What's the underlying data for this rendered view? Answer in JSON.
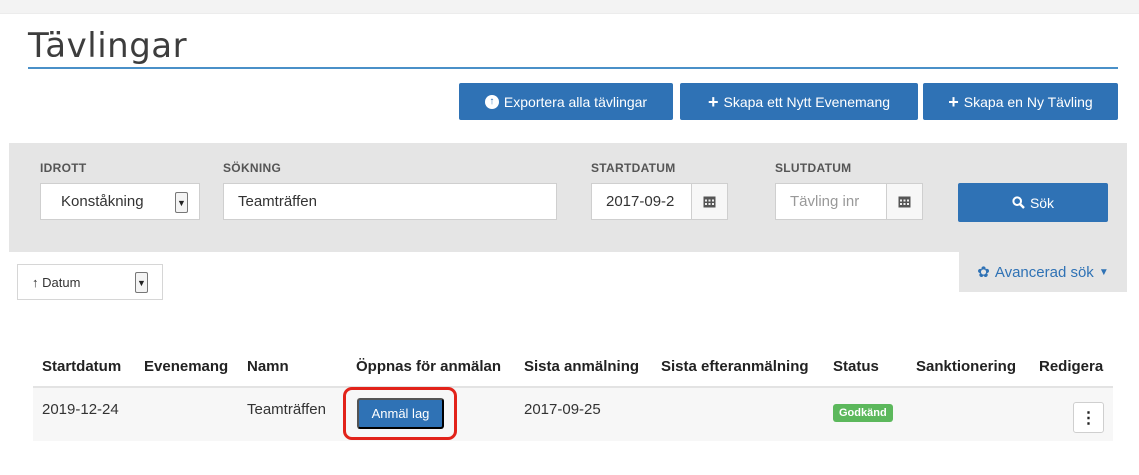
{
  "page": {
    "title": "Tävlingar"
  },
  "actions": {
    "export_label": "Exportera alla tävlingar",
    "create_event_label": "Skapa ett Nytt Evenemang",
    "create_competition_label": "Skapa en Ny Tävling"
  },
  "filters": {
    "sport": {
      "label": "IDROTT",
      "value": "Konståkning"
    },
    "search": {
      "label": "SÖKNING",
      "value": "Teamträffen"
    },
    "start_date": {
      "label": "STARTDATUM",
      "value": "2017-09-2"
    },
    "end_date": {
      "label": "SLUTDATUM",
      "placeholder": "Tävling inr"
    },
    "search_button_label": "Sök",
    "advanced_label": "Avancerad sök"
  },
  "sort": {
    "value": "↑ Datum"
  },
  "table": {
    "columns": [
      "Startdatum",
      "Evenemang",
      "Namn",
      "Öppnas för anmälan",
      "Sista anmälning",
      "Sista efteranmälning",
      "Status",
      "Sanktionering",
      "Redigera"
    ],
    "rows": [
      {
        "startdatum": "2019-12-24",
        "evenemang": "",
        "namn": "Teamträffen",
        "oppnas_button": "Anmäl lag",
        "sista_anmalning": "2017-09-25",
        "sista_efteranmalning": "",
        "status": "Godkänd",
        "sanktionering": "",
        "redigera_icon": "⋮"
      }
    ]
  },
  "colors": {
    "primary": "#2f72b5",
    "panel": "#e5e5e5",
    "success": "#5cb85c",
    "highlight": "#e2231a"
  },
  "icons": [
    "upload-circle-icon",
    "plus-icon",
    "calendar-icon",
    "search-icon",
    "gear-icon",
    "caret-down-icon",
    "kebab-menu-icon"
  ]
}
